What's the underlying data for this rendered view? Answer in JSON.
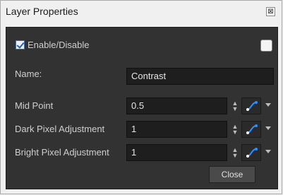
{
  "window": {
    "title": "Layer Properties",
    "close_glyph": "⊠"
  },
  "enable": {
    "label": "Enable/Disable",
    "checked": true
  },
  "name": {
    "label": "Name:",
    "value": "Contrast"
  },
  "params": [
    {
      "label": "Mid Point",
      "value": "0.5"
    },
    {
      "label": "Dark Pixel Adjustment",
      "value": "1"
    },
    {
      "label": "Bright Pixel Adjustment",
      "value": "1"
    }
  ],
  "buttons": {
    "close": "Close"
  },
  "colors": {
    "panel": "#323232",
    "field": "#1e1e1e",
    "function_icon": "#2f8fff"
  },
  "icons": {
    "spinner": "spinner-icon",
    "function": "function-curve-icon",
    "dropdown": "chevron-down-icon"
  }
}
